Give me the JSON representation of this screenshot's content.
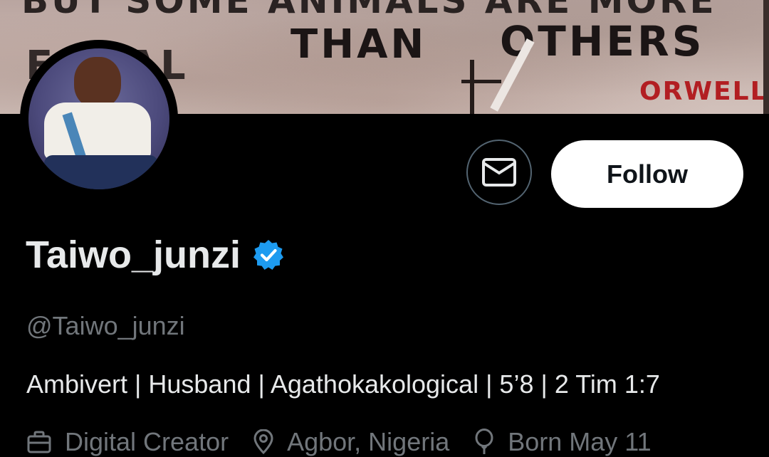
{
  "banner": {
    "line_top": "BUT SOME ANIMALS ARE MORE",
    "line_eq": "EQUAL",
    "line_than": "THAN",
    "line_others": "OTHERS",
    "signature": "ORWELL"
  },
  "profile": {
    "display_name": "Taiwo_junzi",
    "handle": "@Taiwo_junzi",
    "bio": "Ambivert | Husband | Agathokakological | 5’8 | 2 Tim 1:7",
    "verified": true,
    "verified_color": "#1d9bf0"
  },
  "actions": {
    "message_icon": "envelope-icon",
    "follow_label": "Follow"
  },
  "meta": {
    "category": {
      "icon": "briefcase-icon",
      "text": "Digital Creator"
    },
    "location": {
      "icon": "location-pin-icon",
      "text": "Agbor, Nigeria"
    },
    "birthday": {
      "icon": "balloon-icon",
      "text": "Born May 11"
    }
  },
  "colors": {
    "background": "#000000",
    "text_primary": "#e7e9ea",
    "text_secondary": "#71767b",
    "button_border": "#536471",
    "follow_bg": "#ffffff"
  }
}
